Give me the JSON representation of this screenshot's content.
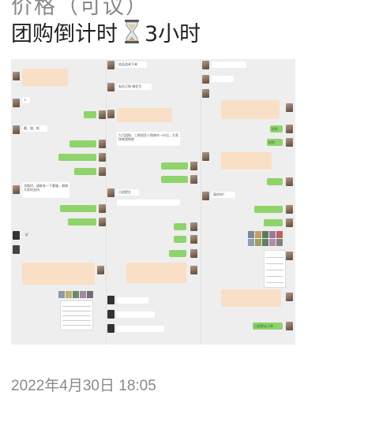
{
  "post": {
    "header_partial": "价格（可议）",
    "headline": "团购倒计时",
    "headline_icon": "hourglass-icon",
    "headline_suffix": "3小时",
    "time": "2022年4月30日 18:05"
  },
  "collage": {
    "col1": {
      "msg_a": "L",
      "msg_b": "圆、粗、框",
      "msg_c": "添购时，请联系一下客服，谢谢大家的支持",
      "msg_d": "好"
    },
    "col2": {
      "msg_a": "欢迎咨询下单",
      "msg_b": "私信订购 微信号",
      "msg_c": "九月团购，三款现货人购物车一价位，大家快来团购吧",
      "msg_d": "已经提交"
    },
    "col3": {
      "msg_a": "好的",
      "msg_b": "好的",
      "msg_c": "真的吗？",
      "msg_d": "已经提交订单"
    }
  },
  "colors": {
    "bubble_green": "#8fd46a",
    "bubble_orange": "#f9dfc6",
    "collage_bg": "#eeeeee"
  }
}
